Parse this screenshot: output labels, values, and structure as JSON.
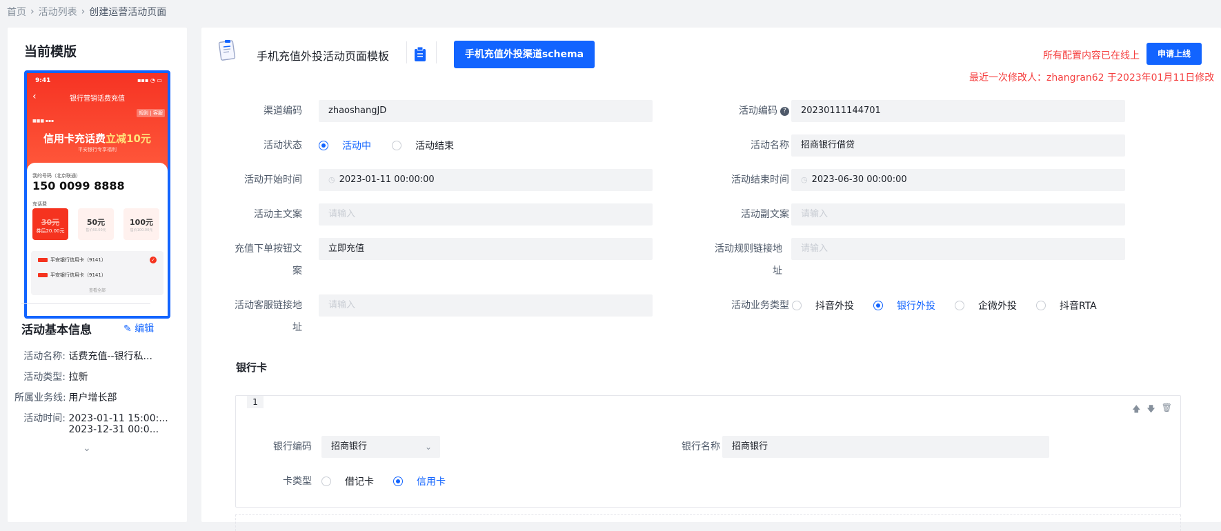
{
  "breadcrumb": {
    "items": [
      "首页",
      "活动列表",
      "创建运营活动页面"
    ]
  },
  "left": {
    "title": "当前模版",
    "phone": {
      "time": "9:41",
      "nav_title": "银行营销话费充值",
      "badge": "规则 | 客服",
      "headline_a": "信用卡充话费",
      "headline_b": "立减10元",
      "subline": "平安银行专享福利",
      "number_label": "我的号码（北京联通）",
      "number": "150 0099 8888",
      "card_label": "充话费",
      "options": [
        {
          "value": "30元",
          "sub": "券后20.00元"
        },
        {
          "value": "50元",
          "sub": "售价50.00元"
        },
        {
          "value": "100元",
          "sub": "售价100.00元"
        }
      ],
      "pay_rows": [
        "平安银行信用卡（9141）",
        "平安银行信用卡（9141）"
      ],
      "more": "查看全部"
    },
    "section_title": "活动基本信息",
    "edit_label": "编辑",
    "info": [
      {
        "k": "活动名称:",
        "v": "话费充值--银行私..."
      },
      {
        "k": "活动类型:",
        "v": "拉新"
      },
      {
        "k": "所属业务线:",
        "v": "用户增长部"
      },
      {
        "k": "活动时间:",
        "v": "2023-01-11 15:00:..."
      },
      {
        "k": "",
        "v": "2023-12-31 00:0..."
      }
    ]
  },
  "header": {
    "template_title": "手机充值外投活动页面模板",
    "schema_button": "手机充值外投渠道schema",
    "online_text": "所有配置内容已在线上",
    "apply_button": "申请上线",
    "modified_text": "最近一次修改人：zhangran62 于2023年01月11日修改"
  },
  "form": {
    "channel_code": {
      "label": "渠道编码",
      "value": "zhaoshangJD"
    },
    "activity_code": {
      "label": "活动编码",
      "value": "20230111144701"
    },
    "status": {
      "label": "活动状态",
      "options": [
        "活动中",
        "活动结束"
      ],
      "selected": "活动中"
    },
    "activity_name": {
      "label": "活动名称",
      "value": "招商银行借贷"
    },
    "start_time": {
      "label": "活动开始时间",
      "value": "2023-01-11 00:00:00"
    },
    "end_time": {
      "label": "活动结束时间",
      "value": "2023-06-30 00:00:00"
    },
    "main_copy": {
      "label": "活动主文案",
      "placeholder": "请输入"
    },
    "sub_copy": {
      "label": "活动副文案",
      "placeholder": "请输入"
    },
    "btn_copy": {
      "label_1": "充值下单按钮文",
      "label_2": "案",
      "value": "立即充值"
    },
    "rules_link": {
      "label_1": "活动规则链接地",
      "label_2": "址",
      "placeholder": "请输入"
    },
    "service_link": {
      "label_1": "活动客服链接地",
      "label_2": "址",
      "placeholder": "请输入"
    },
    "biz_type": {
      "label": "活动业务类型",
      "options": [
        "抖音外投",
        "银行外投",
        "企微外投",
        "抖音RTA"
      ],
      "selected": "银行外投"
    }
  },
  "bank_section": {
    "title": "银行卡",
    "index": "1",
    "bank_code": {
      "label": "银行编码",
      "value": "招商银行"
    },
    "bank_name": {
      "label": "银行名称",
      "value": "招商银行"
    },
    "card_type": {
      "label": "卡类型",
      "options": [
        "借记卡",
        "信用卡"
      ],
      "selected": "信用卡"
    }
  },
  "colors": {
    "primary": "#1264ff",
    "danger": "#f53f3f",
    "input_bg": "#f2f3f5"
  }
}
